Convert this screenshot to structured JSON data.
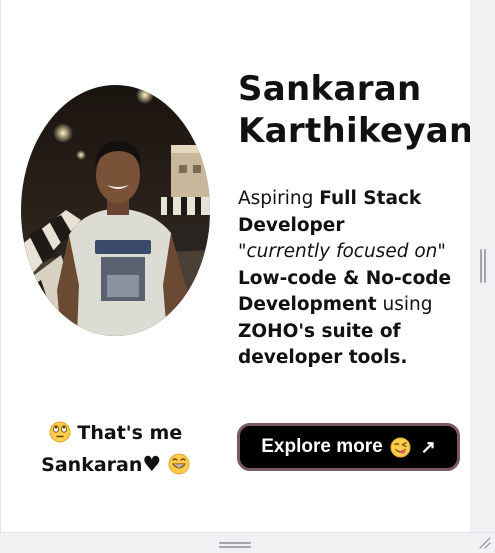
{
  "profile": {
    "first_name": "Sankaran",
    "last_name": "Karthikeyan"
  },
  "bio": {
    "prefix": "Aspiring ",
    "role": "Full Stack Developer",
    "quote": "\"currently focused on\"",
    "focus": "Low-code & No-code Development",
    "using": " using ",
    "tools": "ZOHO's suite of developer tools."
  },
  "caption": {
    "line1": " That's me",
    "line2_name": "Sankaran",
    "heart": "♥"
  },
  "cta": {
    "label": "Explore more",
    "arrow": "↗"
  },
  "icons": {
    "eye_roll": "face-with-rolling-eyes-icon",
    "grin": "grinning-face-icon",
    "yum": "face-savoring-food-icon"
  }
}
